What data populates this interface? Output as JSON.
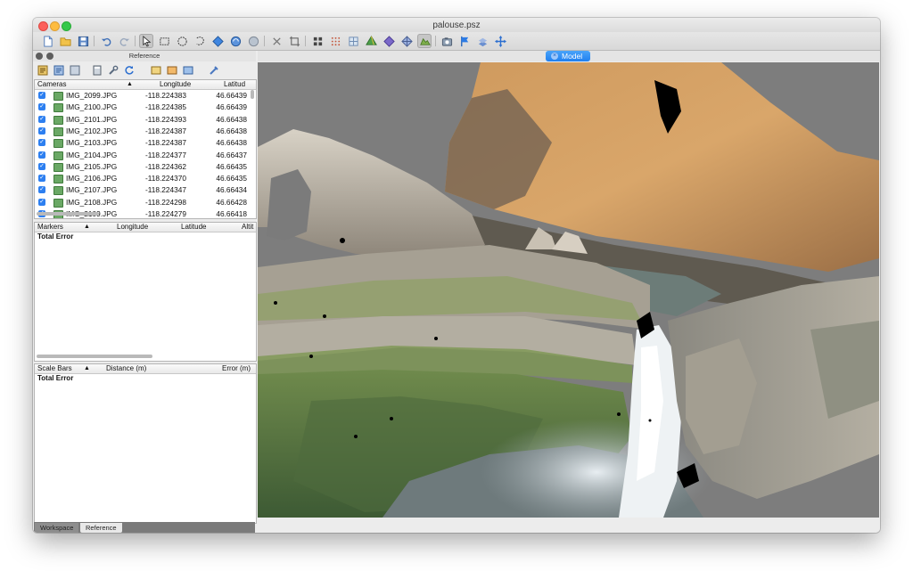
{
  "window": {
    "title": "palouse.psz"
  },
  "reference_panel": {
    "title": "Reference",
    "cameras": {
      "columns": [
        "Cameras",
        "Longitude",
        "Latitud"
      ],
      "rows": [
        {
          "name": "IMG_2099.JPG",
          "longitude": "-118.224383",
          "latitude": "46.66439"
        },
        {
          "name": "IMG_2100.JPG",
          "longitude": "-118.224385",
          "latitude": "46.66439"
        },
        {
          "name": "IMG_2101.JPG",
          "longitude": "-118.224393",
          "latitude": "46.66438"
        },
        {
          "name": "IMG_2102.JPG",
          "longitude": "-118.224387",
          "latitude": "46.66438"
        },
        {
          "name": "IMG_2103.JPG",
          "longitude": "-118.224387",
          "latitude": "46.66438"
        },
        {
          "name": "IMG_2104.JPG",
          "longitude": "-118.224377",
          "latitude": "46.66437"
        },
        {
          "name": "IMG_2105.JPG",
          "longitude": "-118.224362",
          "latitude": "46.66435"
        },
        {
          "name": "IMG_2106.JPG",
          "longitude": "-118.224370",
          "latitude": "46.66435"
        },
        {
          "name": "IMG_2107.JPG",
          "longitude": "-118.224347",
          "latitude": "46.66434"
        },
        {
          "name": "IMG_2108.JPG",
          "longitude": "-118.224298",
          "latitude": "46.66428"
        },
        {
          "name": "IMG_2109.JPG",
          "longitude": "-118.224279",
          "latitude": "46.66418"
        }
      ]
    },
    "markers": {
      "columns": [
        "Markers",
        "Longitude",
        "Latitude",
        "Altit"
      ],
      "total_error": "Total Error"
    },
    "scale_bars": {
      "columns": [
        "Scale Bars",
        "Distance (m)",
        "Error (m)"
      ],
      "total_error": "Total Error"
    },
    "tabs": [
      "Workspace",
      "Reference"
    ]
  },
  "viewport": {
    "tab_label": "Model"
  },
  "colors": {
    "accent": "#1f7ff0",
    "close": "#fc605b",
    "minimize": "#fdbc40",
    "zoom": "#34c84a"
  }
}
